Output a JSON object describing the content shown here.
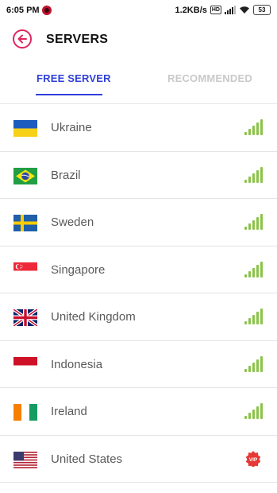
{
  "status_bar": {
    "time": "6:05 PM",
    "speed": "1.2KB/s",
    "network_badge": "HD",
    "battery": "53"
  },
  "header": {
    "title": "SERVERS"
  },
  "tabs": [
    {
      "label": "FREE SERVER",
      "active": true
    },
    {
      "label": "RECOMMENDED",
      "active": false
    }
  ],
  "servers": [
    {
      "name": "Ukraine",
      "flag": "ukraine-flag",
      "status": "signal-full"
    },
    {
      "name": "Brazil",
      "flag": "brazil-flag",
      "status": "signal-full"
    },
    {
      "name": "Sweden",
      "flag": "sweden-flag",
      "status": "signal-full"
    },
    {
      "name": "Singapore",
      "flag": "singapore-flag",
      "status": "signal-full"
    },
    {
      "name": "United Kingdom",
      "flag": "uk-flag",
      "status": "signal-full"
    },
    {
      "name": "Indonesia",
      "flag": "indonesia-flag",
      "status": "signal-full"
    },
    {
      "name": "Ireland",
      "flag": "ireland-flag",
      "status": "signal-full"
    },
    {
      "name": "United States",
      "flag": "us-flag",
      "status": "vip"
    }
  ],
  "vip_badge": "VIP",
  "colors": {
    "accent_blue": "#2f3fd9",
    "back_red": "#e0265f",
    "signal_green": "#8bc34a",
    "vip_red": "#e53935"
  }
}
